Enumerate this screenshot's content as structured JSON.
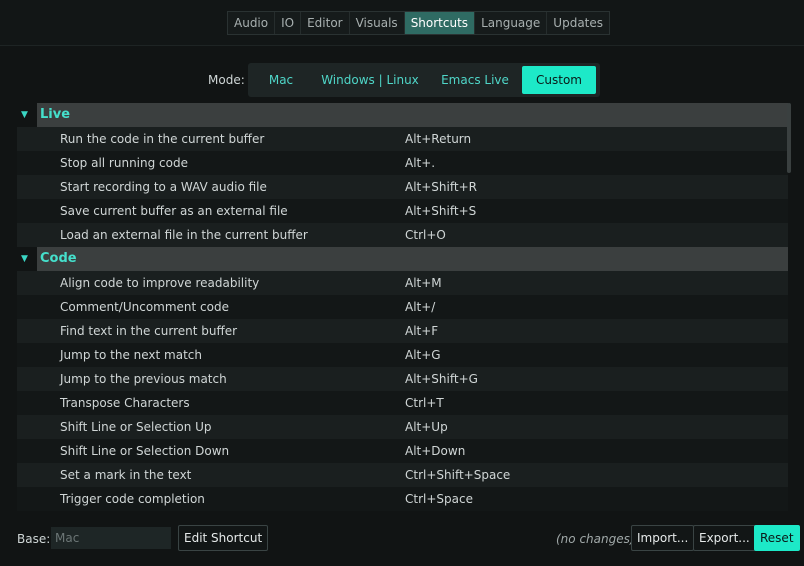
{
  "tabs": [
    "Audio",
    "IO",
    "Editor",
    "Visuals",
    "Shortcuts",
    "Language",
    "Updates"
  ],
  "active_tab": "Shortcuts",
  "mode": {
    "label": "Mode:",
    "options": [
      "Mac",
      "Windows | Linux",
      "Emacs Live",
      "Custom"
    ],
    "selected": "Custom"
  },
  "categories": [
    {
      "name": "Live",
      "items": [
        {
          "desc": "Run the code in the current buffer",
          "key": "Alt+Return"
        },
        {
          "desc": "Stop all running code",
          "key": "Alt+."
        },
        {
          "desc": "Start recording to a WAV audio file",
          "key": "Alt+Shift+R"
        },
        {
          "desc": "Save current buffer as an external file",
          "key": "Alt+Shift+S"
        },
        {
          "desc": "Load an external file in the current buffer",
          "key": "Ctrl+O"
        }
      ]
    },
    {
      "name": "Code",
      "items": [
        {
          "desc": "Align code to improve readability",
          "key": "Alt+M"
        },
        {
          "desc": "Comment/Uncomment code",
          "key": "Alt+/"
        },
        {
          "desc": "Find text in the current buffer",
          "key": "Alt+F"
        },
        {
          "desc": "Jump to the next match",
          "key": "Alt+G"
        },
        {
          "desc": "Jump to the previous match",
          "key": "Alt+Shift+G"
        },
        {
          "desc": "Transpose Characters",
          "key": "Ctrl+T"
        },
        {
          "desc": "Shift Line or Selection Up",
          "key": "Alt+Up"
        },
        {
          "desc": "Shift Line or Selection Down",
          "key": "Alt+Down"
        },
        {
          "desc": "Set a mark in the text",
          "key": "Ctrl+Shift+Space"
        },
        {
          "desc": "Trigger code completion",
          "key": "Ctrl+Space"
        }
      ]
    }
  ],
  "bottom": {
    "base_label": "Base:",
    "base_value": "Mac",
    "edit_label": "Edit Shortcut",
    "status": "(no changes)",
    "import_label": "Import...",
    "export_label": "Export...",
    "reset_label": "Reset"
  },
  "colors": {
    "accent": "#1de9c8",
    "active_tab": "#2f6b63",
    "category_text": "#45e0cc"
  }
}
